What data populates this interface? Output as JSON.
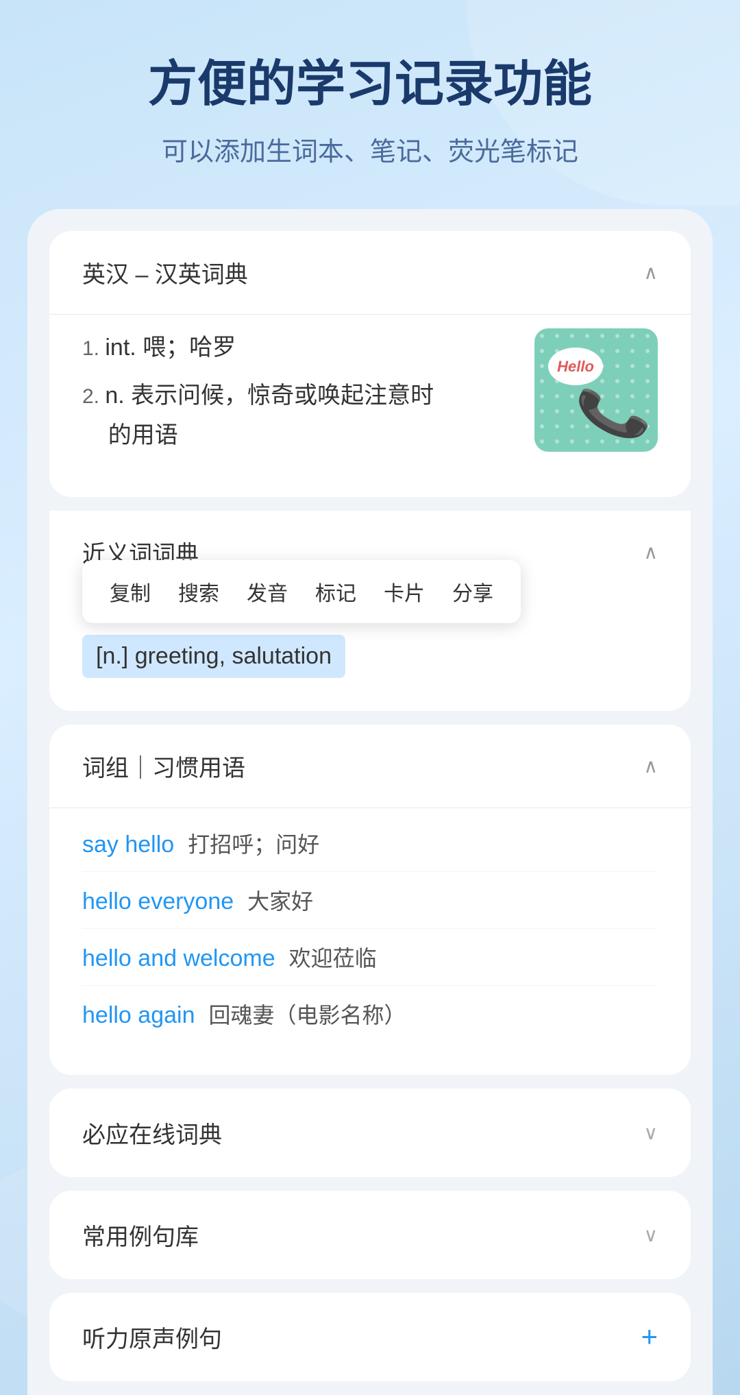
{
  "header": {
    "title": "方便的学习记录功能",
    "subtitle": "可以添加生词本、笔记、荧光笔标记"
  },
  "dictionary": {
    "section_title": "英汉 – 汉英词典",
    "definitions": [
      {
        "number": "1.",
        "type": "int.",
        "meaning": "喂；哈罗"
      },
      {
        "number": "2.",
        "type": "n.",
        "meaning": "表示问候，惊奇或唤起注意时的用语"
      }
    ],
    "image_alt": "Hello telephone illustration"
  },
  "synonyms": {
    "section_title": "近义词词典",
    "context_menu": {
      "items": [
        "复制",
        "搜索",
        "发音",
        "标记",
        "卡片",
        "分享"
      ]
    },
    "selected_text": "[n.] greeting, salutation"
  },
  "phrases": {
    "section_title": "词组｜习惯用语",
    "items": [
      {
        "english": "say hello",
        "chinese": "打招呼；问好"
      },
      {
        "english": "hello everyone",
        "chinese": "大家好"
      },
      {
        "english": "hello and welcome",
        "chinese": "欢迎莅临"
      },
      {
        "english": "hello again",
        "chinese": "回魂妻（电影名称）"
      }
    ]
  },
  "collapsed_sections": [
    {
      "title": "必应在线词典"
    },
    {
      "title": "常用例句库"
    }
  ],
  "plus_section": {
    "title": "听力原声例句",
    "icon": "+"
  },
  "icons": {
    "chevron_up": "∧",
    "chevron_down": "∨",
    "plus": "+"
  }
}
